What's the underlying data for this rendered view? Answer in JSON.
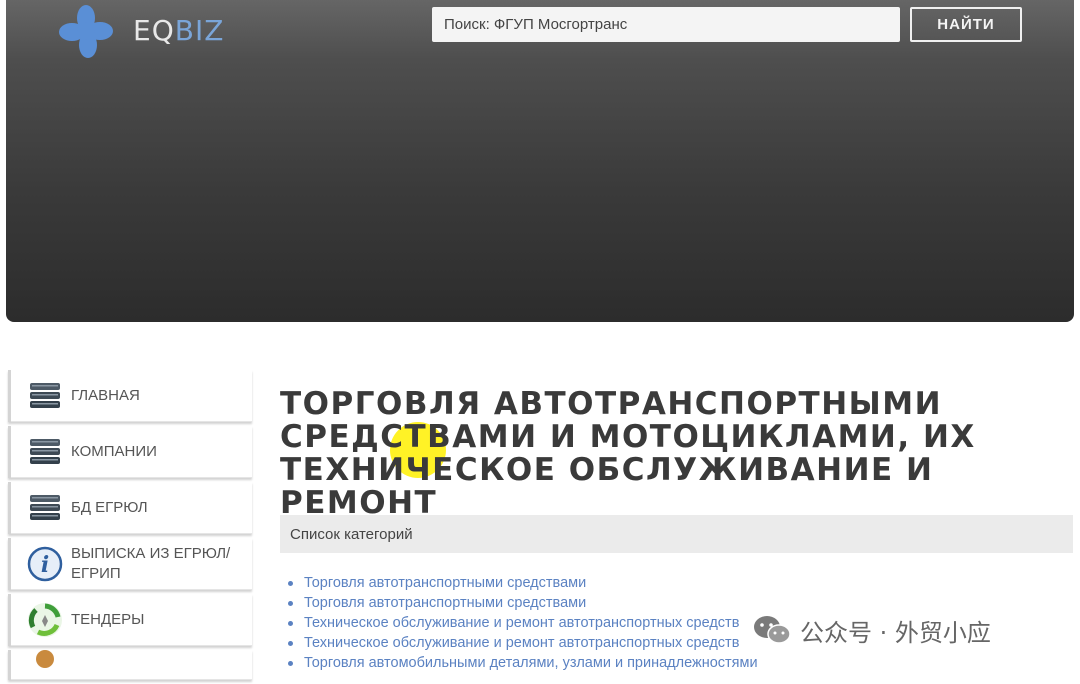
{
  "header": {
    "logo": {
      "part1": "EQ",
      "part2": "BIZ"
    },
    "search": {
      "placeholder": "Поиск: ФГУП Мосгортранс",
      "button_label": "НАЙТИ"
    }
  },
  "sidebar": {
    "items": [
      {
        "label": "ГЛАВНАЯ",
        "icon": "database-icon"
      },
      {
        "label": "КОМПАНИИ",
        "icon": "database-icon"
      },
      {
        "label": "БД ЕГРЮЛ",
        "icon": "database-icon"
      },
      {
        "label": "ВЫПИСКА ИЗ ЕГРЮЛ/ ЕГРИП",
        "icon": "info-icon"
      },
      {
        "label": "ТЕНДЕРЫ",
        "icon": "recycle-icon"
      }
    ]
  },
  "main": {
    "title": "ТОРГОВЛЯ АВТОТРАНСПОРТНЫМИ СРЕДСТВАМИ И МОТОЦИКЛАМИ, ИХ ТЕХНИЧЕСКОЕ ОБСЛУЖИВАНИЕ И РЕМОНТ",
    "categories_header": "Список категорий",
    "categories": [
      "Торговля автотранспортными средствами",
      "Торговля автотранспортными средствами",
      "Техническое обслуживание и ремонт автотранспортных средств",
      "Техническое обслуживание и ремонт автотранспортных средств",
      "Торговля автомобильными деталями, узлами и принадлежностями"
    ]
  },
  "watermark": {
    "text": "公众号 · 外贸小应"
  },
  "colors": {
    "banner_dark": "#2c2c2c",
    "link": "#5b82c2",
    "logo_accent": "#7aa5d8",
    "highlight": "#fff000"
  }
}
